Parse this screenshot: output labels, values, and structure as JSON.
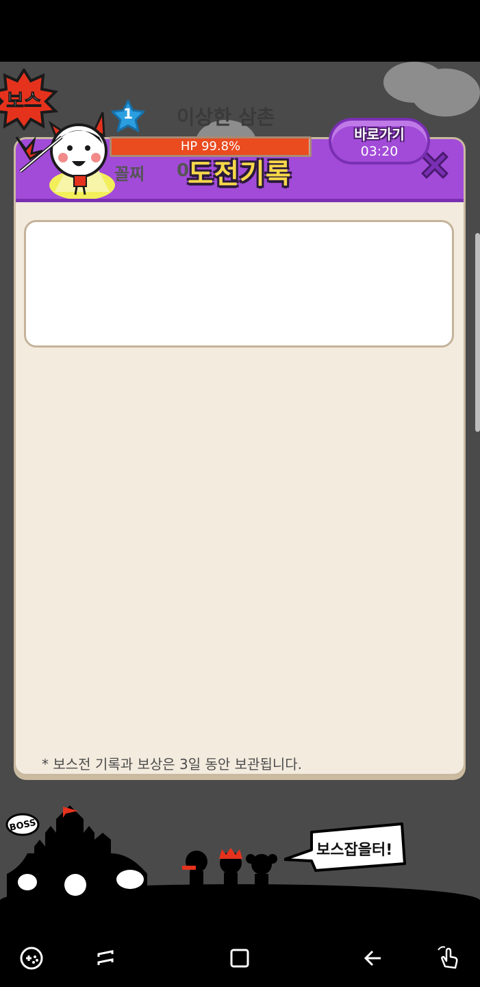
{
  "popup": {
    "title": "도전기록",
    "close_label": "",
    "footnote": "* 보스전 기록과 보상은 3일 동안 보관됩니다."
  },
  "record": {
    "badge": "보스",
    "rank_badge": "1",
    "boss_name": "이상한 삼촌",
    "hp_text": "HP 99.8%",
    "hp_percent": 99.8,
    "rank_label": "꼴찌",
    "rank_value": "0",
    "goto_label": "바로가기",
    "goto_time": "03:20"
  },
  "scene": {
    "castle_tag": "BOSS",
    "speech": "보스잡을터!"
  },
  "nav": {
    "icons": [
      "game-tools-icon",
      "recent-apps-icon",
      "home-icon",
      "back-icon",
      "touch-gesture-icon"
    ]
  },
  "colors": {
    "header": "#a24bd8",
    "title": "#f6d84a",
    "hp_fill": "#ea4b1f",
    "panel": "#f3ebde",
    "background": "#4a4a4a"
  }
}
